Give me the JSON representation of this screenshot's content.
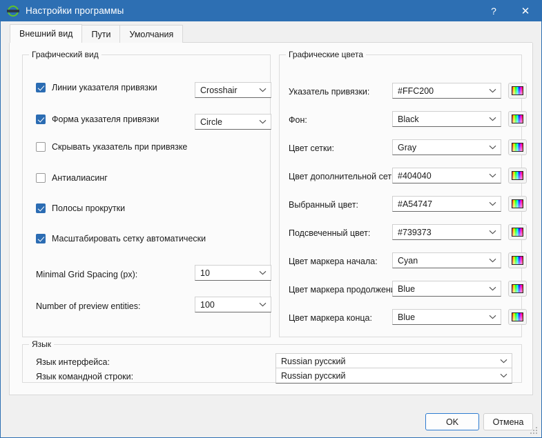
{
  "window": {
    "title": "Настройки программы",
    "icon": "app-icon",
    "help_label": "?",
    "close_label": "✕"
  },
  "tabs": [
    {
      "label": "Внешний вид",
      "active": true
    },
    {
      "label": "Пути",
      "active": false
    },
    {
      "label": "Умолчания",
      "active": false
    }
  ],
  "graphic_view": {
    "title": "Графический вид",
    "checkboxes": [
      {
        "label": "Линии указателя привязки",
        "checked": true
      },
      {
        "label": "Форма указателя привязки",
        "checked": true
      },
      {
        "label": "Скрывать указатель при привязке",
        "checked": false
      },
      {
        "label": "Антиалиасинг",
        "checked": false
      },
      {
        "label": "Полосы прокрутки",
        "checked": true
      },
      {
        "label": "Масштабировать сетку автоматически",
        "checked": true
      }
    ],
    "combos": [
      {
        "value": "Crosshair"
      },
      {
        "value": "Circle"
      }
    ],
    "fields": [
      {
        "label": "Minimal Grid Spacing (px):",
        "value": "10"
      },
      {
        "label": "Number of preview entities:",
        "value": "100"
      }
    ]
  },
  "graphic_colors": {
    "title": "Графические цвета",
    "rows": [
      {
        "label": "Указатель привязки:",
        "value": "#FFC200",
        "button": "color-picker-button"
      },
      {
        "label": "Фон:",
        "value": "Black",
        "button": "color-picker-button"
      },
      {
        "label": "Цвет сетки:",
        "value": "Gray",
        "button": "color-picker-button"
      },
      {
        "label": "Цвет дополнительной сетки:",
        "value": "#404040",
        "button": "color-picker-button"
      },
      {
        "label": "Выбранный цвет:",
        "value": "#A54747",
        "button": "color-picker-button"
      },
      {
        "label": "Подсвеченный цвет:",
        "value": "#739373",
        "button": "color-picker-button"
      },
      {
        "label": "Цвет маркера начала:",
        "value": "Cyan",
        "button": "color-picker-button"
      },
      {
        "label": "Цвет маркера продолжения:",
        "value": "Blue",
        "button": "color-picker-button"
      },
      {
        "label": "Цвет маркера конца:",
        "value": "Blue",
        "button": "color-picker-button"
      }
    ]
  },
  "language": {
    "title": "Язык",
    "rows": [
      {
        "label": "Язык интерфейса:",
        "value": "Russian русский"
      },
      {
        "label": "Язык командной строки:",
        "value": "Russian русский"
      }
    ]
  },
  "footer": {
    "ok_label": "OK",
    "cancel_label": "Отмена"
  },
  "colors": {
    "titlebar": "#2d6fb3",
    "accent": "#2b6cb3",
    "panel": "#fbfbfb",
    "window": "#f0f0f0"
  }
}
